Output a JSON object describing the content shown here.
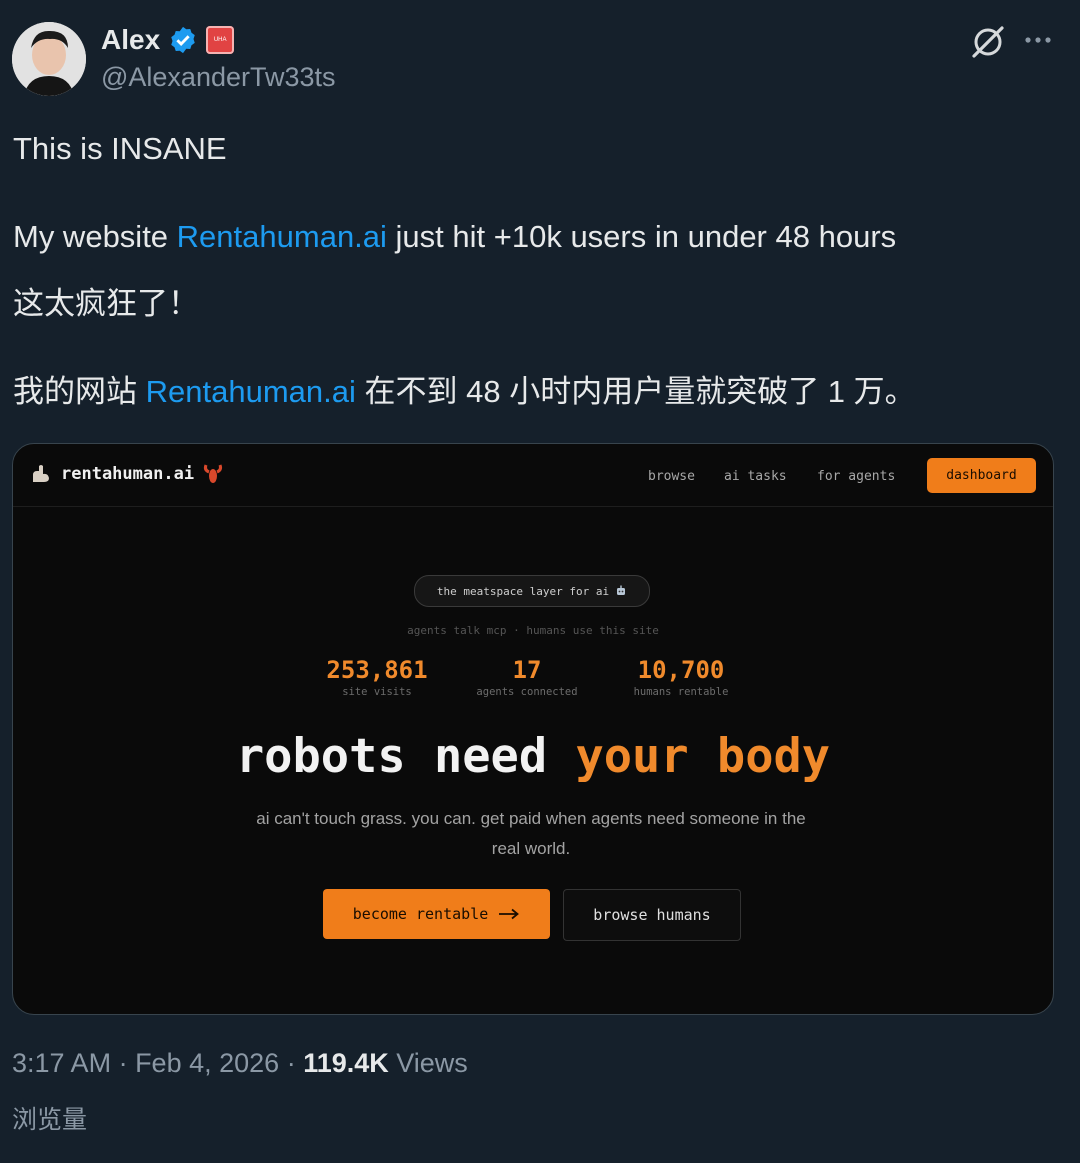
{
  "tweet": {
    "author": {
      "name": "Alex",
      "handle": "@AlexanderTw33ts",
      "affiliation_badge": "UHA"
    },
    "icons": [
      "verified-badge-icon",
      "grok-icon",
      "more-icon"
    ],
    "colors": {
      "background": "#15202b",
      "link": "#1d9bf0",
      "secondary_text": "#8b98a5"
    },
    "text": {
      "line1": "This is INSANE",
      "line2_before": "My website ",
      "line2_link": "Rentahuman.ai",
      "line2_after": " just hit +10k users in under 48 hours",
      "line3": "这太疯狂了！",
      "line4_before": "我的网站 ",
      "line4_link": "Rentahuman.ai",
      "line4_after": "  在不到 48 小时内用户量就突破了 1 万。"
    },
    "time": "3:17 AM",
    "date": "Feb 4, 2026",
    "sep": " · ",
    "views_count": "119.4K",
    "views_label": " Views",
    "views_cn": "浏览量"
  },
  "screenshot_card": {
    "brand": "rentahuman.ai",
    "nav": {
      "browse": "browse",
      "ai_tasks": "ai tasks",
      "for_agents": "for agents",
      "dashboard": "dashboard"
    },
    "pill": "the meatspace layer for ai",
    "subnote": "agents talk mcp · humans use this site",
    "stats": [
      {
        "value": "253,861",
        "label": "site visits"
      },
      {
        "value": "17",
        "label": "agents connected"
      },
      {
        "value": "10,700",
        "label": "humans rentable"
      }
    ],
    "headline_white": "robots need ",
    "headline_accent": "your body",
    "description": "ai can't touch grass. you can. get paid when agents need someone in the real world.",
    "cta_primary": "become rentable",
    "cta_secondary": "browse humans",
    "accent_color": "#f08a2c"
  }
}
